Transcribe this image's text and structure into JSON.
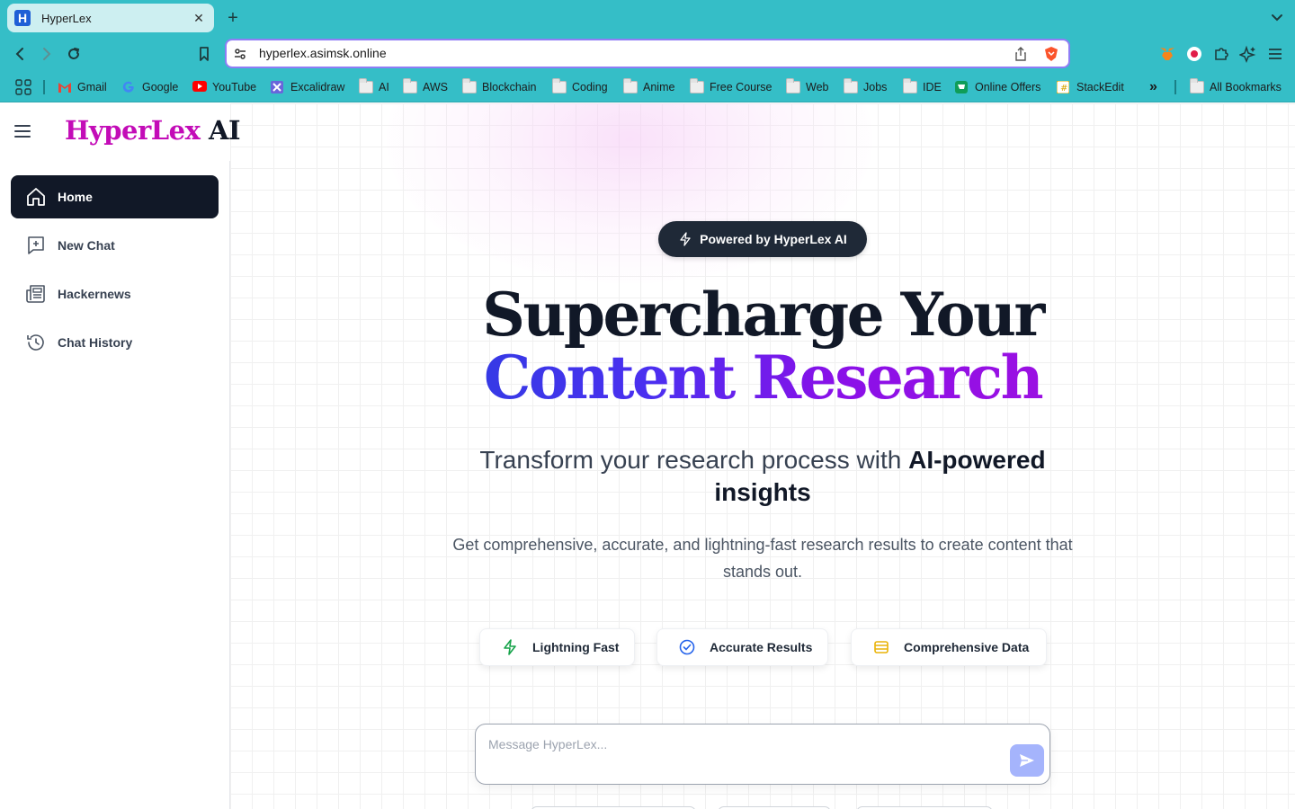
{
  "browser": {
    "tab_title": "HyperLex",
    "tab_favicon_letter": "H",
    "new_tab_symbol": "+",
    "url": "hyperlex.asimsk.online",
    "theme_color": "#35bec7"
  },
  "bookmarks": {
    "items": [
      {
        "label": "Gmail",
        "icon": "gmail-icon"
      },
      {
        "label": "Google",
        "icon": "google-icon"
      },
      {
        "label": "YouTube",
        "icon": "youtube-icon"
      },
      {
        "label": "Excalidraw",
        "icon": "excalidraw-icon"
      },
      {
        "label": "AI",
        "icon": "folder-icon"
      },
      {
        "label": "AWS",
        "icon": "folder-icon"
      },
      {
        "label": "Blockchain",
        "icon": "folder-icon"
      },
      {
        "label": "Coding",
        "icon": "folder-icon"
      },
      {
        "label": "Anime",
        "icon": "folder-icon"
      },
      {
        "label": "Free Course",
        "icon": "folder-icon"
      },
      {
        "label": "Web",
        "icon": "folder-icon"
      },
      {
        "label": "Jobs",
        "icon": "folder-icon"
      },
      {
        "label": "IDE",
        "icon": "folder-icon"
      },
      {
        "label": "Online Offers",
        "icon": "offers-icon"
      },
      {
        "label": "StackEdit",
        "icon": "stackedit-icon"
      }
    ],
    "overflow_symbol": "»",
    "all_bookmarks": "All Bookmarks"
  },
  "app": {
    "logo_brand": "HyperLex",
    "logo_suffix": "AI",
    "brand_color": "#c30cb7"
  },
  "sidebar": {
    "items": [
      {
        "label": "Home",
        "icon": "home-icon",
        "active": true
      },
      {
        "label": "New Chat",
        "icon": "new-chat-icon",
        "active": false
      },
      {
        "label": "Hackernews",
        "icon": "newspaper-icon",
        "active": false
      },
      {
        "label": "Chat History",
        "icon": "history-icon",
        "active": false
      }
    ]
  },
  "main": {
    "badge": "Powered by HyperLex AI",
    "headline_line1": "Supercharge Your",
    "headline_line2": "Content Research",
    "subheading_plain": "Transform your research process with ",
    "subheading_bold": "AI-powered insights",
    "description": "Get comprehensive, accurate, and lightning-fast research results to create content that stands out.",
    "features": [
      {
        "label": "Lightning Fast",
        "icon": "lightning-icon",
        "color": "#16a34a"
      },
      {
        "label": "Accurate Results",
        "icon": "check-circle-icon",
        "color": "#2563eb"
      },
      {
        "label": "Comprehensive Data",
        "icon": "database-icon",
        "color": "#eab308"
      }
    ],
    "chat": {
      "placeholder": "Message HyperLex...",
      "send_button_color": "#a5b4fc"
    }
  }
}
